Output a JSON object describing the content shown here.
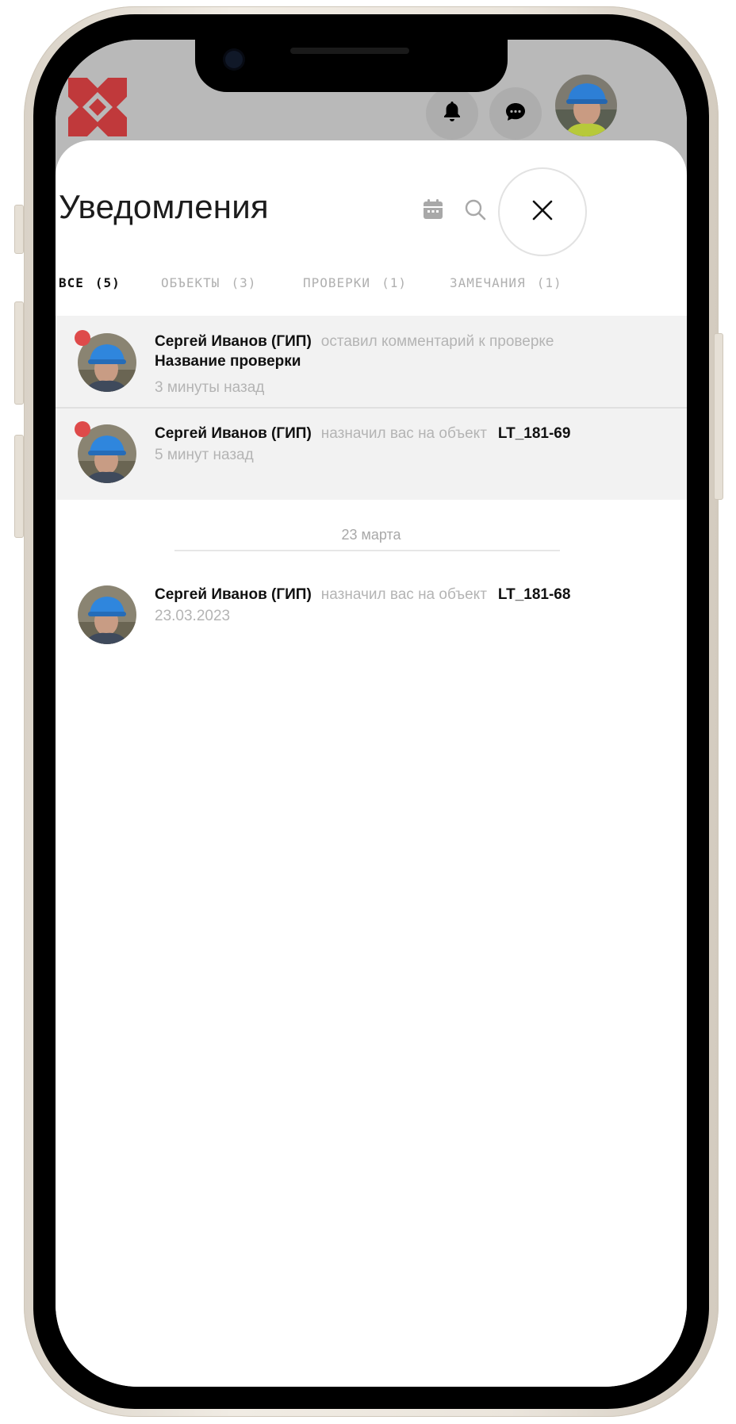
{
  "header": {
    "logo": "logo-icon",
    "bell_icon": "bell-icon",
    "chat_icon": "chat-icon",
    "avatar": "user-avatar"
  },
  "sheet": {
    "title": "Уведомления",
    "calendar_icon": "calendar-icon",
    "search_icon": "search-icon",
    "close_icon": "close-icon"
  },
  "tabs": [
    {
      "label": "ВСЕ",
      "count": "(5)",
      "active": true
    },
    {
      "label": "ОБЪЕКТЫ",
      "count": "(3)",
      "active": false
    },
    {
      "label": "ПРОВЕРКИ",
      "count": "(1)",
      "active": false
    },
    {
      "label": "ЗАМЕЧАНИЯ",
      "count": "(1)",
      "active": false
    }
  ],
  "notifications": [
    {
      "author": "Сергей Иванов (ГИП)",
      "action": "оставил комментарий к проверке",
      "subject": "Название проверки",
      "object": "",
      "time": "3 минуты назад",
      "unread": true
    },
    {
      "author": "Сергей Иванов (ГИП)",
      "action": "назначил вас на объект",
      "subject": "",
      "object": "LT_181-69",
      "time": "5 минут назад",
      "unread": true
    }
  ],
  "date_separator": "23 марта",
  "older_notifications": [
    {
      "author": "Сергей Иванов (ГИП)",
      "action": "назначил вас на объект",
      "object": "LT_181-68",
      "time": "23.03.2023",
      "unread": false
    }
  ],
  "colors": {
    "accent_red": "#c0393b",
    "unread_dot": "#de4a4a",
    "muted_text": "#b4b4b4"
  }
}
